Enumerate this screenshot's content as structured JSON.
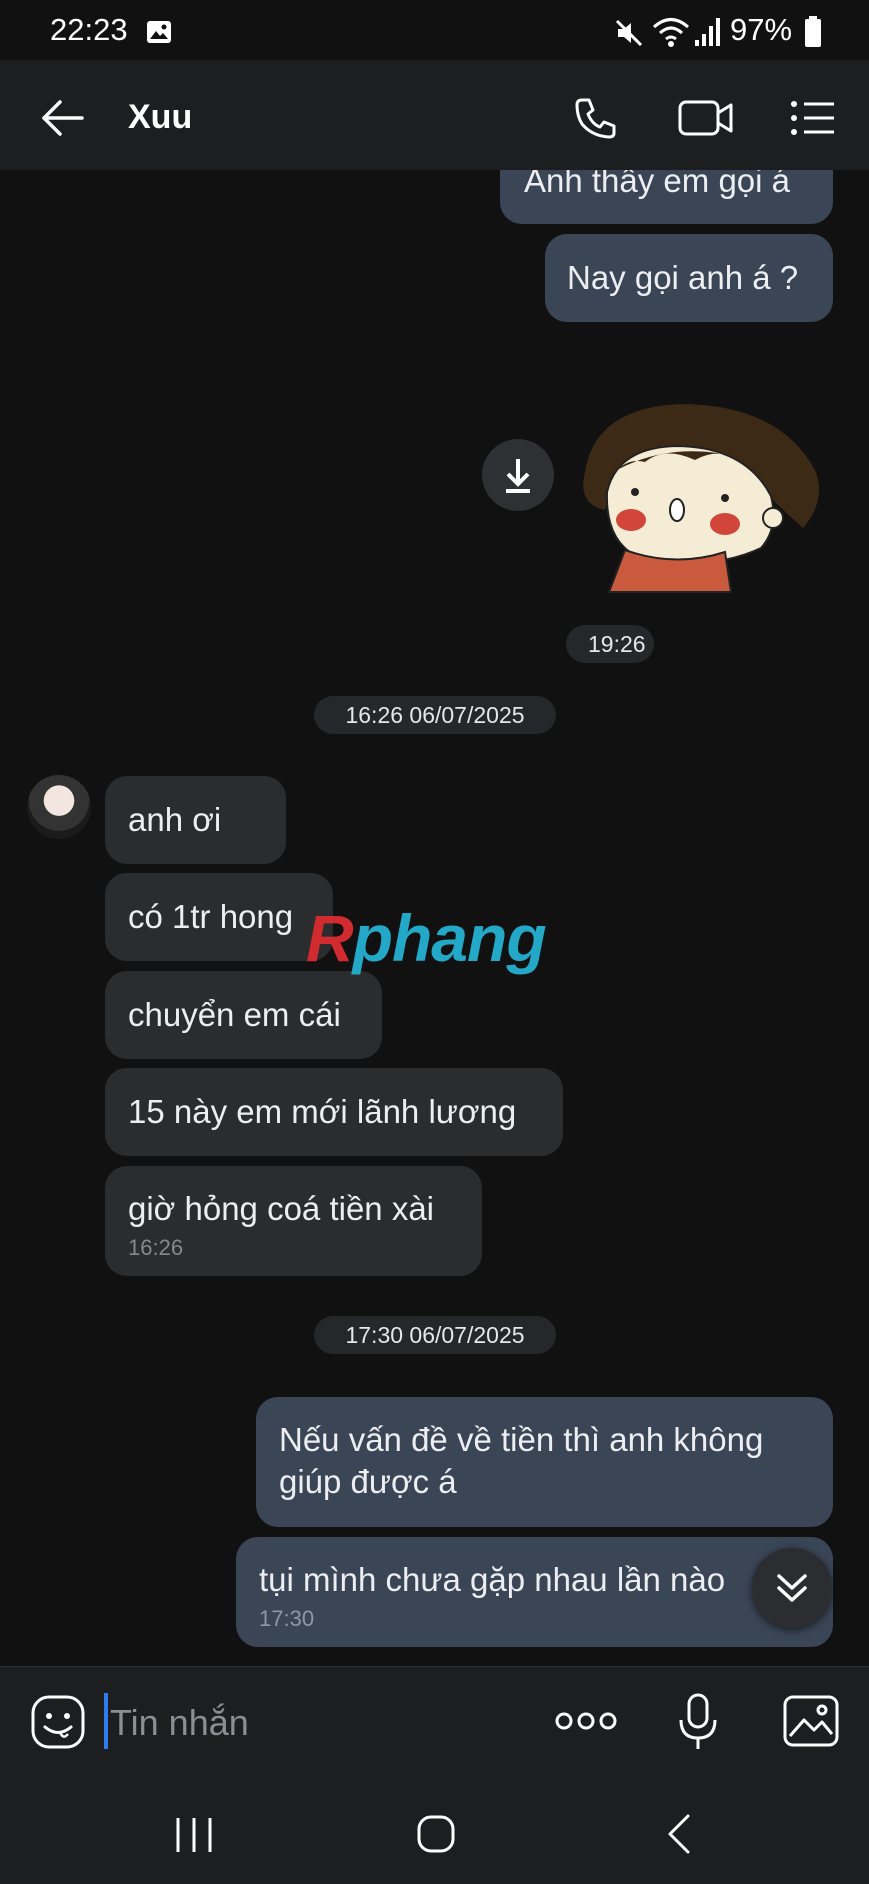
{
  "status_bar": {
    "time": "22:23",
    "battery": "97%",
    "icons": [
      "gallery-icon",
      "mute-icon",
      "wifi-icon",
      "signal-icon",
      "battery-icon"
    ]
  },
  "header": {
    "contact_name": "Xuu",
    "icons": [
      "back-arrow-icon",
      "phone-call-icon",
      "video-call-icon",
      "menu-list-icon"
    ]
  },
  "messages": {
    "out_top_partial": "Anh thấy em gọi á",
    "out_call_today": "Nay gọi anh á ?",
    "sticker_time": "19:26",
    "date_separator_1": "16:26 06/07/2025",
    "incoming": [
      "anh ơi",
      "có 1tr hong",
      "chuyển em cái",
      "15 này em mới lãnh lương",
      "giờ hỏng coá tiền xài"
    ],
    "incoming_time": "16:26",
    "date_separator_2": "17:30 06/07/2025",
    "outgoing_reply": [
      "Nếu vấn đề về tiền thì anh không giúp được á",
      "tụi mình chưa gặp nhau lần nào"
    ],
    "outgoing_time": "17:30"
  },
  "watermark": {
    "first_letter": "R",
    "rest": "phang"
  },
  "composer": {
    "placeholder": "Tin nhắn",
    "value": ""
  },
  "colors": {
    "background": "#111111",
    "header": "#1d1e20",
    "outgoing_bubble": "#3a4556",
    "incoming_bubble": "#2b2c2e",
    "cursor": "#2f7bf0"
  }
}
